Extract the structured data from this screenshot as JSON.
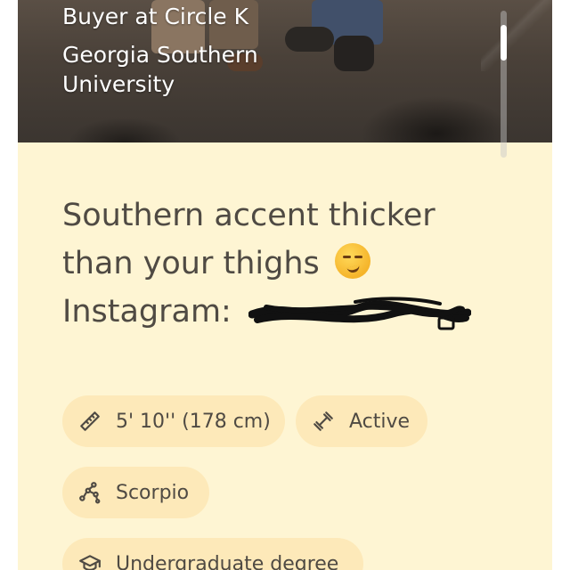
{
  "profile": {
    "job": "Buyer at Circle K",
    "school": "Georgia Southern University",
    "bio_line1": "Southern accent thicker",
    "bio_line2": "than your thighs",
    "bio_emoji": "smirking-face-emoji",
    "bio_line3_prefix": "Instagram:",
    "instagram_handle": "[redacted]"
  },
  "attributes": {
    "height": "5' 10'' (178 cm)",
    "activity": "Active",
    "zodiac": "Scorpio",
    "education": "Undergraduate degree"
  },
  "icons": {
    "height": "ruler-icon",
    "activity": "dumbbell-icon",
    "zodiac": "constellation-icon",
    "education": "graduation-cap-icon"
  },
  "colors": {
    "card_background": "#fef5d3",
    "chip_background": "#fde9b9",
    "text": "#4f4a43"
  }
}
